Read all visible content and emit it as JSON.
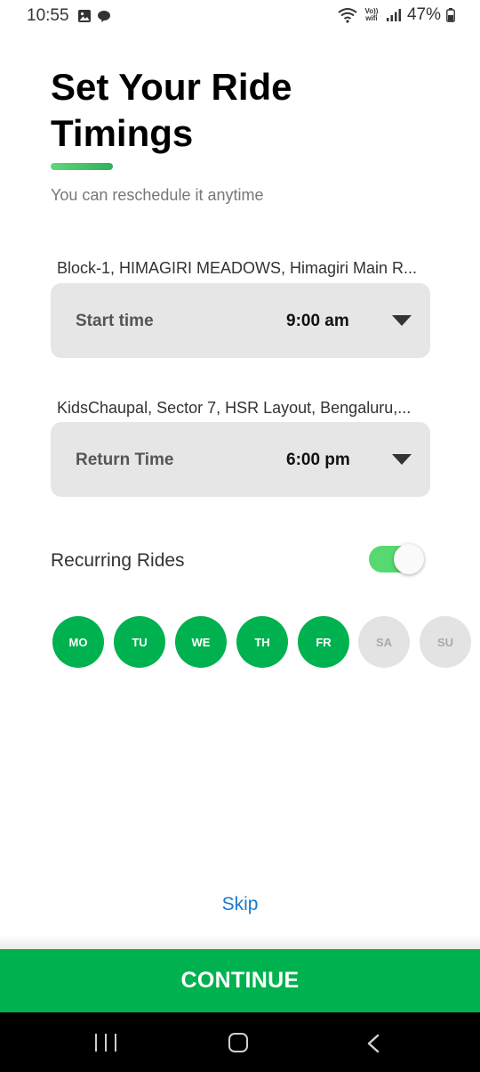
{
  "status_bar": {
    "time": "10:55",
    "network_label": "Vo)) wifi",
    "battery_percent": "47%"
  },
  "header": {
    "title": "Set Your Ride Timings",
    "subtitle": "You can reschedule it anytime",
    "accent_color": "#3cc76a"
  },
  "pickup": {
    "location": "Block-1, HIMAGIRI MEADOWS, Himagiri Main R...",
    "label": "Start time",
    "value": "9:00 am"
  },
  "return": {
    "location": "KidsChaupal, Sector 7, HSR Layout, Bengaluru,...",
    "label": "Return Time",
    "value": "6:00 pm"
  },
  "recurring": {
    "label": "Recurring Rides",
    "enabled": true
  },
  "days": [
    {
      "label": "MO",
      "selected": true
    },
    {
      "label": "TU",
      "selected": true
    },
    {
      "label": "WE",
      "selected": true
    },
    {
      "label": "TH",
      "selected": true
    },
    {
      "label": "FR",
      "selected": true
    },
    {
      "label": "SA",
      "selected": false
    },
    {
      "label": "SU",
      "selected": false
    }
  ],
  "footer": {
    "skip_label": "Skip",
    "continue_label": "CONTINUE",
    "primary_color": "#00b14f",
    "link_color": "#1a79c9"
  },
  "icons": {
    "status_left": [
      "gallery-icon",
      "chat-icon"
    ],
    "status_right": [
      "wifi-icon",
      "signal-icon",
      "battery-icon"
    ],
    "nav": [
      "recent-apps-icon",
      "home-icon",
      "back-icon"
    ]
  }
}
